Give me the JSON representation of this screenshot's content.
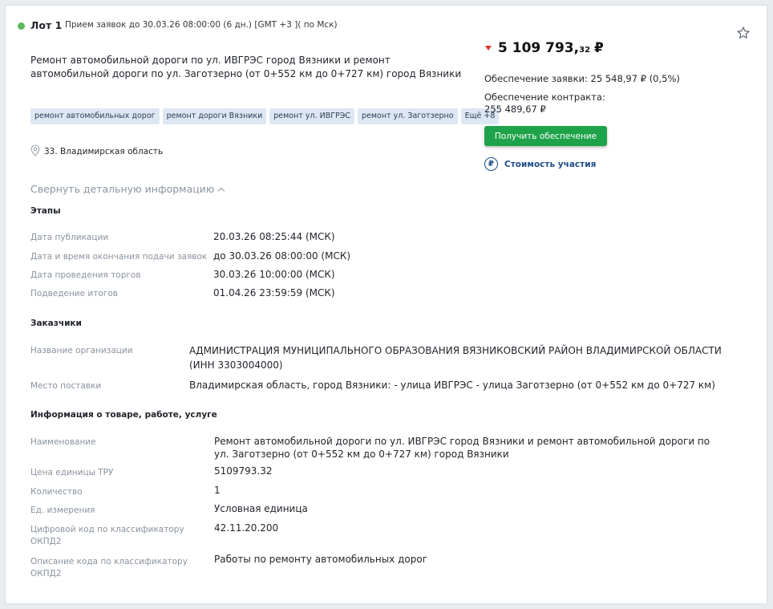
{
  "lot": {
    "label": "Лот 1",
    "deadline": "Прием заявок до  30.03.26 08:00:00 (6 дн.) [GMT +3 ]( по Мск)",
    "title": "Ремонт автомобильной дороги по ул. ИВГРЭС город Вязники и ремонт автомобильной дороги по ул. Заготзерно (от 0+552 км до 0+727 км) город Вязники",
    "tags": [
      "ремонт автомобильных дорог",
      "ремонт дороги Вязники",
      "ремонт ул. ИВГРЭС",
      "ремонт ул. Заготзерно",
      "Ещё +8"
    ],
    "region": "33. Владимирская область"
  },
  "price": {
    "main": "5 109 793,",
    "cents": "32",
    "currency": "₽",
    "application_security": "Обеспечение заявки:  25 548,97 ₽ (0,5%)",
    "contract_security_label": "Обеспечение контракта:",
    "contract_security_value": "255 489,67  ₽",
    "get_security_button": "Получить обеспечение",
    "cost_link": "Стоимость участия"
  },
  "collapse_label": "Свернуть детальную информацию",
  "stages": {
    "heading": "Этапы",
    "rows": [
      {
        "label": "Дата публикации",
        "value": "20.03.26 08:25:44 (МСК)"
      },
      {
        "label": "Дата и время окончания подачи заявок",
        "value": "до 30.03.26 08:00:00 (МСК)"
      },
      {
        "label": "Дата проведения торгов",
        "value": "30.03.26 10:00:00 (МСК)"
      },
      {
        "label": "Подведение итогов",
        "value": "01.04.26 23:59:59 (МСК)"
      }
    ]
  },
  "customers": {
    "heading": "Заказчики",
    "rows": [
      {
        "label": "Название организации",
        "value": "АДМИНИСТРАЦИЯ МУНИЦИПАЛЬНОГО ОБРАЗОВАНИЯ ВЯЗНИКОВСКИЙ РАЙОН ВЛАДИМИРСКОЙ ОБЛАСТИ (ИНН 3303004000)"
      },
      {
        "label": "Место поставки",
        "value": "Владимирская область, город Вязники: - улица ИВГРЭС - улица Заготзерно (от 0+552 км до 0+727 км)"
      }
    ]
  },
  "goods": {
    "heading": "Информация о товаре, работе, услуге",
    "rows": [
      {
        "label": "Наименование",
        "value": "Ремонт автомобильной дороги по ул. ИВГРЭС город Вязники и ремонт автомобильной дороги по ул. Заготзерно (от 0+552 км до 0+727 км) город Вязники"
      },
      {
        "label": "Цена единицы ТРУ",
        "value": "5109793.32"
      },
      {
        "label": "Количество",
        "value": "1"
      },
      {
        "label": "Ед. измерения",
        "value": "Условная единица"
      },
      {
        "label": "Цифровой код по классификатору ОКПД2",
        "value": "42.11.20.200"
      },
      {
        "label": "Описание кода по классификатору ОКПД2",
        "value": "Работы по ремонту автомобильных дорог"
      }
    ]
  },
  "colors": {
    "accent_green": "#1fa34a",
    "link_blue": "#1e4f8a",
    "status_dot": "#5cb85c",
    "price_down": "#d9352c"
  },
  "icons": [
    "status-dot-icon",
    "star-icon",
    "location-pin-icon",
    "price-down-icon",
    "ruble-icon",
    "chevron-up-icon"
  ]
}
